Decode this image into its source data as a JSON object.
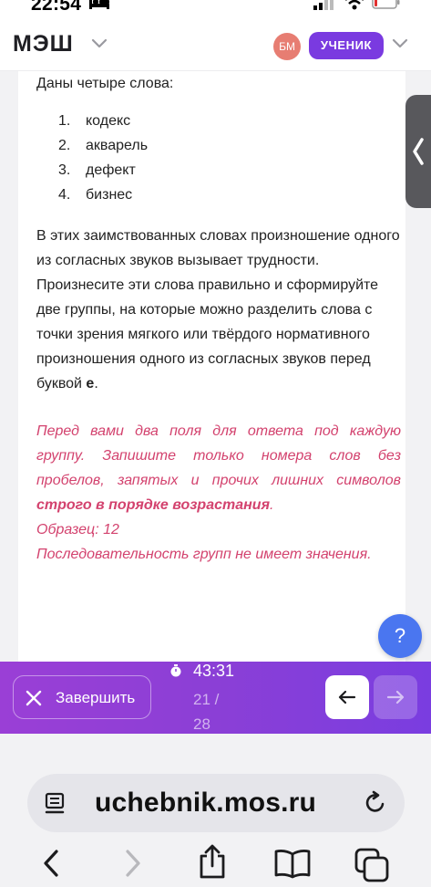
{
  "status_bar": {
    "time": "22:54",
    "icons": [
      "bed-icon",
      "signal-icon",
      "wifi-icon",
      "battery-icon"
    ]
  },
  "header": {
    "logo": "МЭШ",
    "avatar_initials": "БМ",
    "role_label": "УЧЕНИК",
    "colors": {
      "avatar": "#e77d72",
      "role": "#7a3ae0"
    }
  },
  "question": {
    "intro": "Даны четыре слова:",
    "words": [
      {
        "num": "1.",
        "text": "кодекс"
      },
      {
        "num": "2.",
        "text": "акварель"
      },
      {
        "num": "3.",
        "text": "дефект"
      },
      {
        "num": "4.",
        "text": "бизнес"
      }
    ],
    "task_main": "В этих заимствованных словах произношение одного из согласных звуков  вызывает трудности. Произнесите эти слова правильно и сформируйте две группы, на которые можно разделить слова с точки зрения мягкого или твёрдого нормативного произношения одного из согласных звуков перед буквой ",
    "task_letter": "е",
    "task_end": ".",
    "instruction_main": "Перед вами два поля для ответа под каждую группу. Запишите только номера слов без пробелов, запятых и прочих лишних символов ",
    "instruction_bold": "строго в порядке возрастания",
    "instruction_end": ".",
    "example": "Образец: 12",
    "note": "Последовательность групп не имеет значения.",
    "instruction_color": "#d3426e"
  },
  "help": {
    "label": "?"
  },
  "bottom_bar": {
    "finish_label": "Завершить",
    "timer": "43:31",
    "progress_current": "21 /",
    "progress_total": "28",
    "gradient_colors": [
      "#9a3fd6",
      "#7a3de0"
    ]
  },
  "browser": {
    "url": "uchebnik.mos.ru"
  }
}
